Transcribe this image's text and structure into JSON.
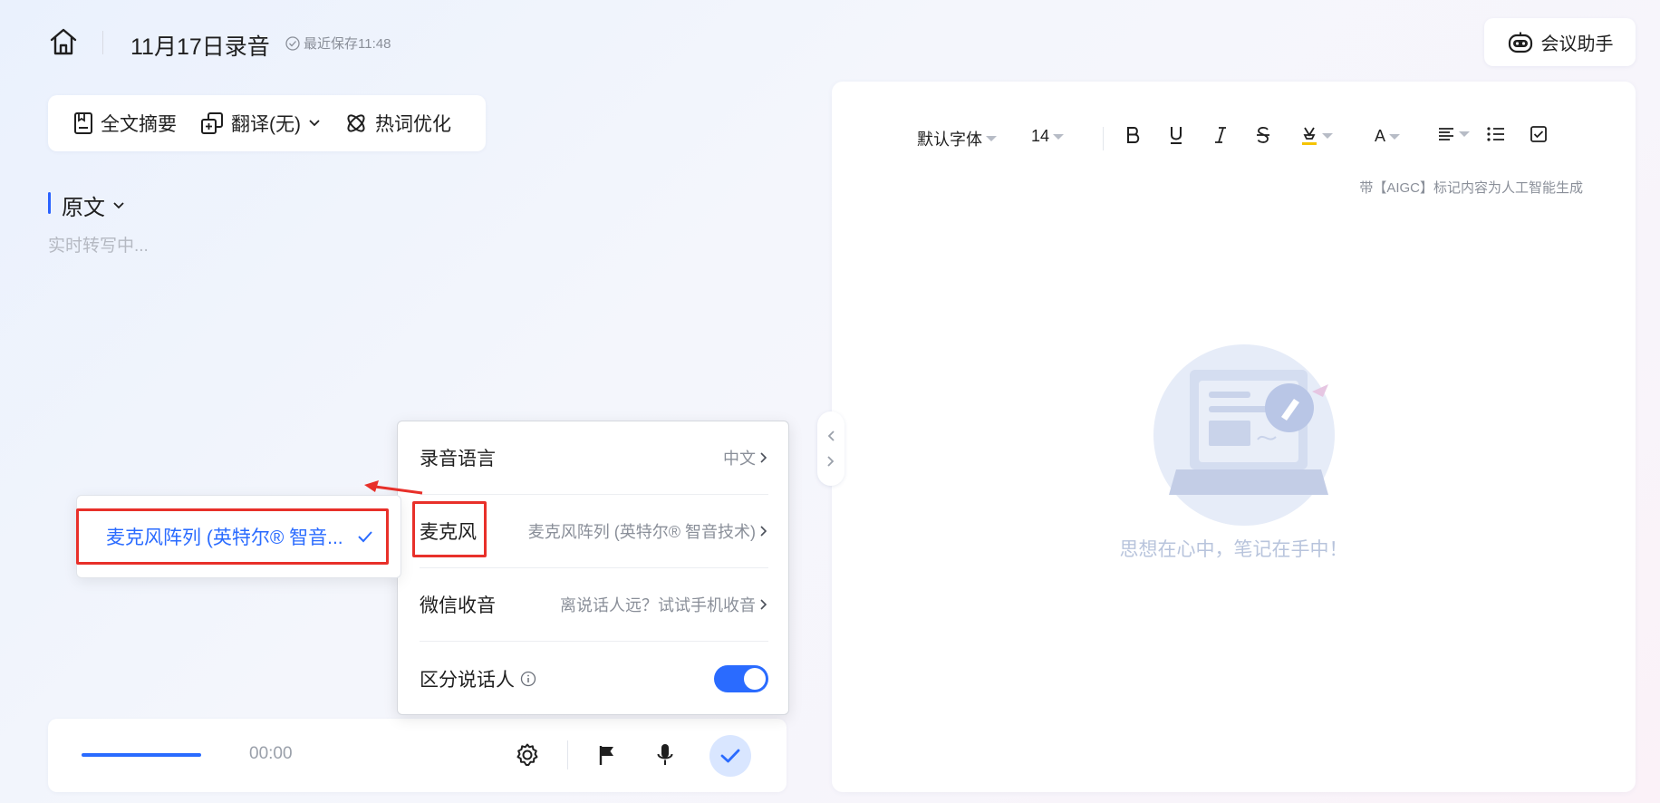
{
  "header": {
    "title": "11月17日录音",
    "save_status": "最近保存11:48",
    "assistant_label": "会议助手"
  },
  "toolbar": {
    "summary_label": "全文摘要",
    "translate_label": "翻译(无)",
    "hotword_label": "热词优化"
  },
  "transcript": {
    "section_title": "原文",
    "status_text": "实时转写中..."
  },
  "recorder": {
    "timer": "00:00"
  },
  "editor": {
    "font_family": "默认字体",
    "font_size": "14",
    "text_color_label": "A",
    "aigc_note": "带【AIGC】标记内容为人工智能生成",
    "empty_text": "思想在心中，笔记在手中！",
    "colors": {
      "highlight": "#f5c400"
    }
  },
  "settings": {
    "rows": [
      {
        "label": "录音语言",
        "value": "中文"
      },
      {
        "label": "麦克风",
        "value": "麦克风阵列 (英特尔® 智音技术)"
      },
      {
        "label": "微信收音",
        "value": "离说话人远？试试手机收音"
      },
      {
        "label": "区分说话人",
        "toggle": true
      }
    ]
  },
  "mic_submenu": {
    "selected_option": "麦克风阵列 (英特尔® 智音..."
  },
  "colors": {
    "accent": "#2a6bff",
    "annotation_red": "#e8302a"
  }
}
